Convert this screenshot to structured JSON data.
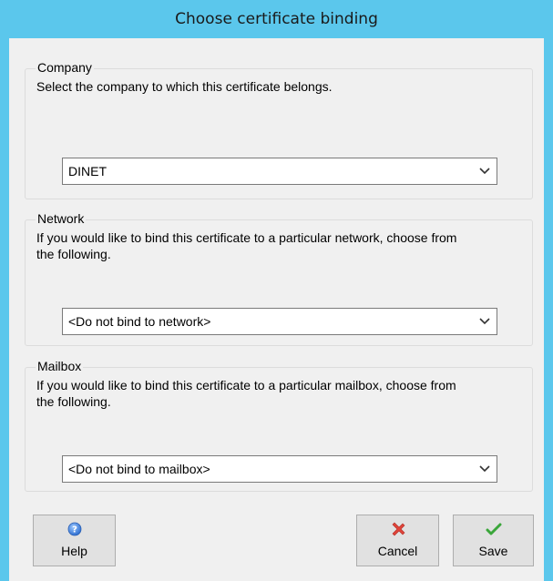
{
  "window": {
    "title": "Choose certificate binding"
  },
  "company": {
    "title": "Company",
    "description": "Select the company to which this certificate belongs.",
    "selected": "DINET"
  },
  "network": {
    "title": "Network",
    "description": "If you would like to bind this certificate to a particular network, choose from the following.",
    "selected": "<Do not bind to network>"
  },
  "mailbox": {
    "title": "Mailbox",
    "description": "If you would like to bind this certificate to a particular mailbox, choose from the following.",
    "selected": "<Do not bind to mailbox>"
  },
  "buttons": {
    "help": {
      "label": "Help",
      "icon": "help-icon"
    },
    "cancel": {
      "label": "Cancel",
      "icon": "cancel-icon"
    },
    "save": {
      "label": "Save",
      "icon": "save-icon"
    }
  },
  "colors": {
    "titlebar": "#5bc7ec",
    "cancel_icon": "#e0443a",
    "save_icon": "#3aa63a",
    "help_icon": "#3a7fd6"
  }
}
